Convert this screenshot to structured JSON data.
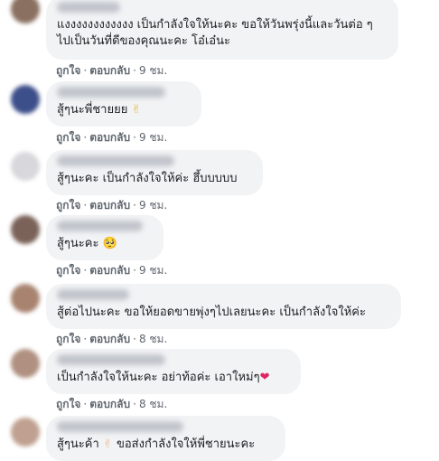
{
  "comments": [
    {
      "text_lines": [
        "แงงงงงงงงงงงง เป็นกำลังใจให้นะคะ ขอให้วันพรุ่งนี้และวันต่อ ๆ",
        "ไปเป็นวันที่ดีของคุณนะคะ โอ๋เอ๋นะ"
      ],
      "emoji": "",
      "like": "ถูกใจ",
      "reply": "ตอบกลับ",
      "time": "9 ชม.",
      "avatar_color": "#8a7060"
    },
    {
      "text_lines": [
        "สู้ๆนะพี่ชายยย"
      ],
      "emoji": "✌",
      "like": "ถูกใจ",
      "reply": "ตอบกลับ",
      "time": "9 ชม.",
      "avatar_color": "#3d4f8a"
    },
    {
      "text_lines": [
        "สู้ๆนะคะ เป็นกำลังใจให้ค่ะ ฮึ้บบบบบ"
      ],
      "emoji": "",
      "like": "ถูกใจ",
      "reply": "ตอบกลับ",
      "time": "9 ชม.",
      "avatar_color": "#d8d8dc"
    },
    {
      "text_lines": [
        "สู้ๆนะคะ"
      ],
      "emoji": "🥺",
      "like": "ถูกใจ",
      "reply": "ตอบกลับ",
      "time": "9 ชม.",
      "avatar_color": "#7a6258"
    },
    {
      "text_lines": [
        "สู้ต่อไปนะคะ ขอให้ยอดขายพุ่งๆไปเลยนะคะ เป็นกำลังใจให้ค่ะ"
      ],
      "emoji": "",
      "like": "ถูกใจ",
      "reply": "ตอบกลับ",
      "time": "8 ชม.",
      "avatar_color": "#a88470"
    },
    {
      "text_lines": [
        "เป็นกำลังใจให้นะคะ อย่าท้อค่ะ เอาใหม่ๆ"
      ],
      "emoji": "❤",
      "like": "ถูกใจ",
      "reply": "ตอบกลับ",
      "time": "8 ชม.",
      "avatar_color": "#b09080"
    },
    {
      "text_lines": [
        "สู้ๆนะค้า"
      ],
      "emoji": "✌",
      "text_after": "ขอส่งกำลังใจให้พี่ชายนะคะ",
      "like": "",
      "reply": "",
      "time": "",
      "avatar_color": "#c0a090"
    }
  ],
  "colors": {
    "bubble": "#f2f3f5",
    "meta_text": "#606770",
    "heart": "#e0245e"
  }
}
